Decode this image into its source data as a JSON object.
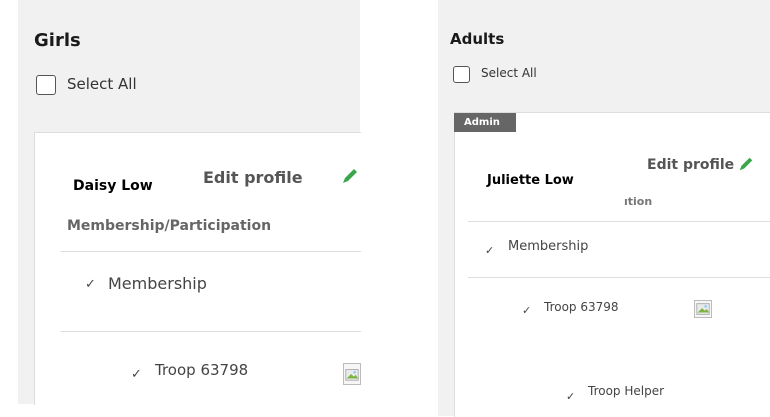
{
  "girls": {
    "title": "Girls",
    "select_all": "Select All",
    "member": {
      "name": "Daisy Low",
      "edit_profile": "Edit profile",
      "membership_header": "Membership/Participation",
      "check_mark": "✓",
      "membership_label": "Membership",
      "troop_label": "Troop 63798"
    }
  },
  "adults": {
    "title": "Adults",
    "select_all": "Select All",
    "member": {
      "badge": "Admin",
      "name": "Juliette Low",
      "edit_profile": "Edit profile",
      "membership_header_partial": "ıtion",
      "check_mark": "✓",
      "membership_label": "Membership",
      "troop_label": "Troop 63798",
      "role_label": "Troop Helper"
    }
  },
  "colors": {
    "panel_bg": "#f1f1f1",
    "card_bg": "#ffffff",
    "pencil": "#3aa64b",
    "badge_bg": "#666666"
  },
  "icons": {
    "edit": "pencil-icon",
    "broken_image": "broken-image-icon"
  }
}
